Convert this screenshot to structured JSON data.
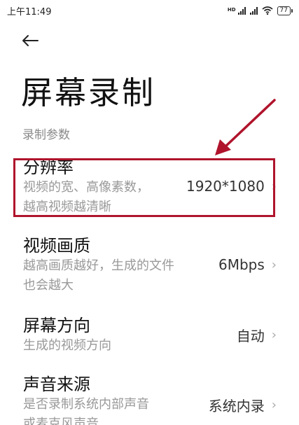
{
  "status_bar": {
    "time": "上午11:49",
    "signal_label": "HD",
    "battery": "77"
  },
  "icons": {
    "back": "back-arrow-icon",
    "chevron": "chevron-right-icon"
  },
  "page": {
    "title": "屏幕录制",
    "section_label": "录制参数"
  },
  "settings": [
    {
      "title": "分辨率",
      "description_lines": [
        "视频的宽、高像素数，",
        "越高视频越清晰"
      ],
      "value": "1920*1080"
    },
    {
      "title": "视频画质",
      "description_lines": [
        "越高画质越好，生成的文件",
        "也会越大"
      ],
      "value": "6Mbps"
    },
    {
      "title": "屏幕方向",
      "description_lines": [
        "生成的视频方向"
      ],
      "value": "自动"
    },
    {
      "title": "声音来源",
      "description_lines": [
        "是否录制系统内部声音",
        "或麦克风声音"
      ],
      "value": "系统内录"
    }
  ],
  "colors": {
    "annotation": "#b0142c",
    "secondary_text": "#999999",
    "section_label": "#8a8a8a"
  }
}
